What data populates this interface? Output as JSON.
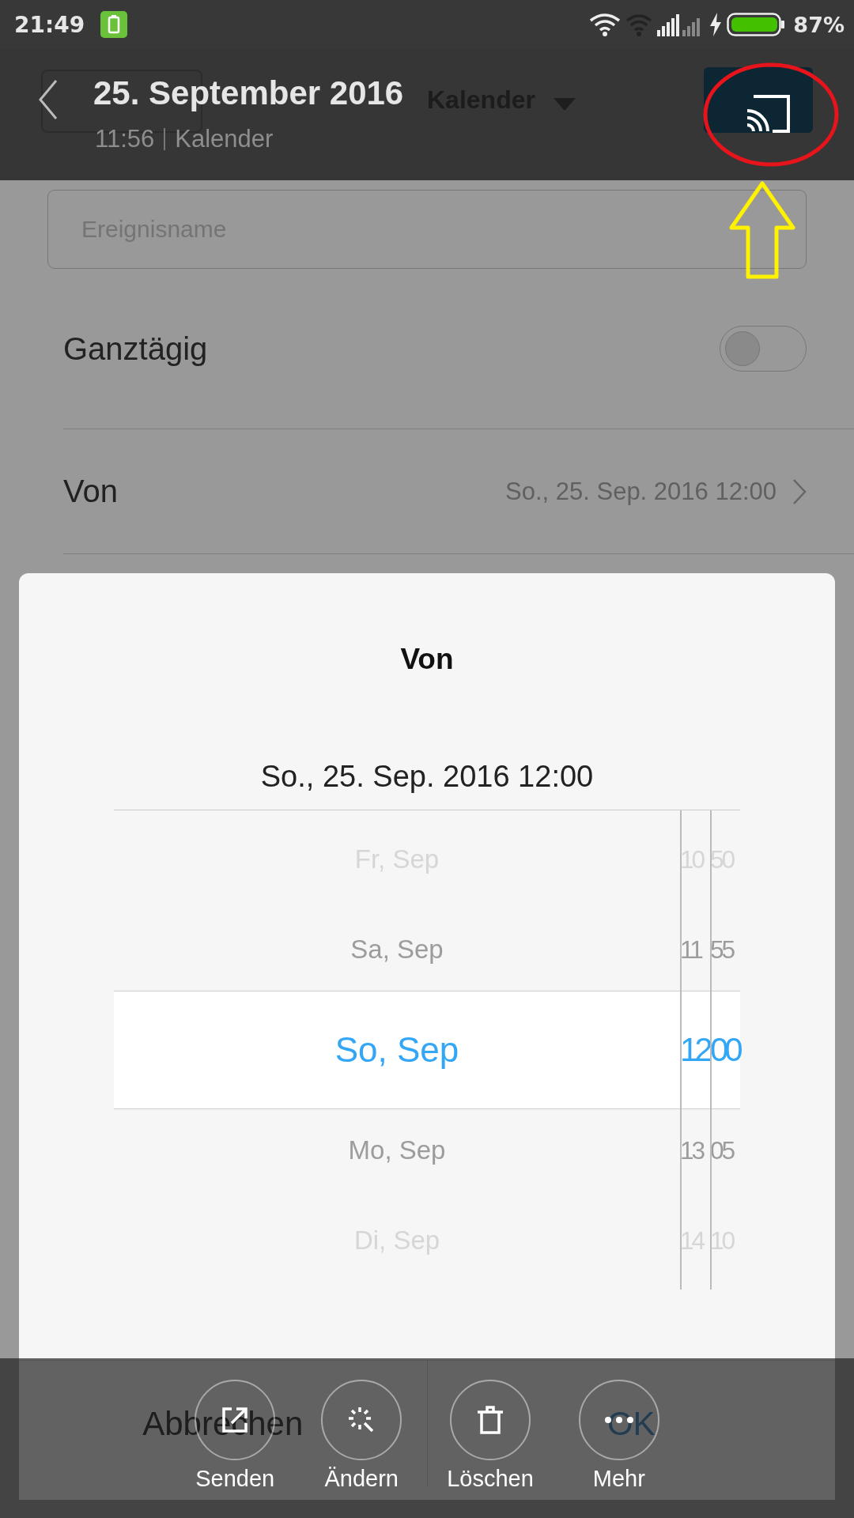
{
  "status_bar": {
    "time": "21:49",
    "battery_text": "87%"
  },
  "viewer_header": {
    "title": "25. September 2016",
    "time": "11:56",
    "album": "Kalender"
  },
  "screenshot": {
    "header": {
      "title": "Kalender"
    },
    "event_name": {
      "placeholder": "Ereignisname"
    },
    "all_day": {
      "label": "Ganztägig",
      "on": false
    },
    "from_row": {
      "label": "Von",
      "value": "So., 25. Sep. 2016 12:00"
    },
    "dialog": {
      "title": "Von",
      "value": "So., 25. Sep. 2016 12:00",
      "rows": [
        {
          "day": "Fr, Sep",
          "hour": "10",
          "minute": "50",
          "selected": false,
          "faded": true
        },
        {
          "day": "Sa, Sep",
          "hour": "11",
          "minute": "55",
          "selected": false,
          "faded": false
        },
        {
          "day": "So, Sep",
          "hour": "12",
          "minute": "00",
          "selected": true,
          "faded": false
        },
        {
          "day": "Mo, Sep",
          "hour": "13",
          "minute": "05",
          "selected": false,
          "faded": false
        },
        {
          "day": "Di, Sep",
          "hour": "14",
          "minute": "10",
          "selected": false,
          "faded": true
        }
      ],
      "buttons": [
        {
          "label": "Abbrechen",
          "kind": "cancel"
        },
        {
          "label": "OK",
          "kind": "confirm"
        }
      ]
    }
  },
  "toolbar": [
    {
      "label": "Senden",
      "kind": "send"
    },
    {
      "label": "Ändern",
      "kind": "edit"
    },
    {
      "label": "Löschen",
      "kind": "delete"
    },
    {
      "label": "Mehr",
      "kind": "more"
    }
  ]
}
